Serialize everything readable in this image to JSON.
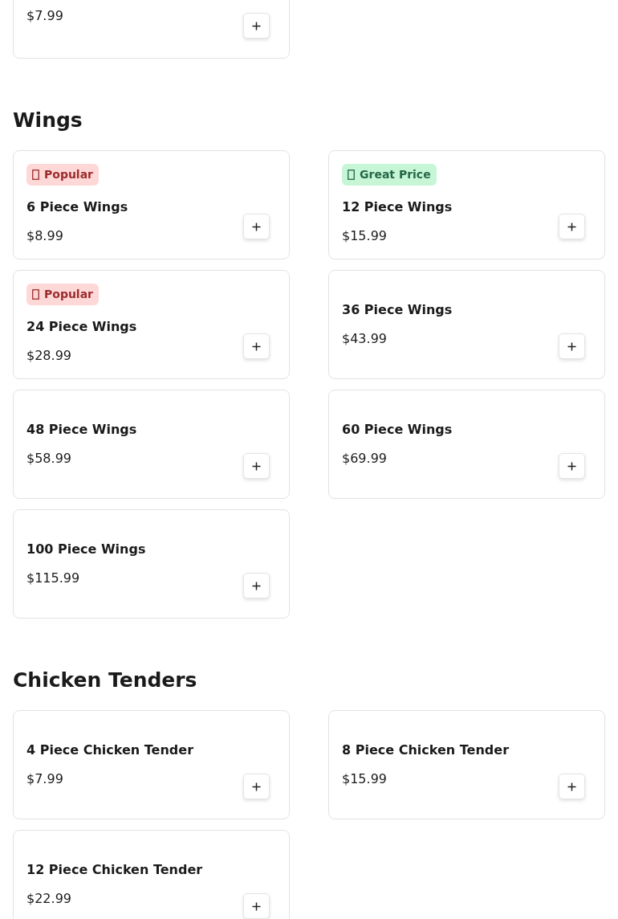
{
  "sections": [
    {
      "items": [
        {
          "price": "$7.99",
          "kind": "partial"
        }
      ]
    },
    {
      "heading": "Wings",
      "items": [
        {
          "badge": {
            "kind": "popular",
            "label": "Popular"
          },
          "name": "6 Piece Wings",
          "price": "$8.99"
        },
        {
          "badge": {
            "kind": "great",
            "label": "Great Price"
          },
          "name": "12 Piece Wings",
          "price": "$15.99"
        },
        {
          "badge": {
            "kind": "popular",
            "label": "Popular"
          },
          "name": "24 Piece Wings",
          "price": "$28.99"
        },
        {
          "name": "36 Piece Wings",
          "price": "$43.99"
        },
        {
          "name": "48 Piece Wings",
          "price": "$58.99"
        },
        {
          "name": "60 Piece Wings",
          "price": "$69.99"
        },
        {
          "name": "100 Piece Wings",
          "price": "$115.99"
        }
      ]
    },
    {
      "heading": "Chicken Tenders",
      "items": [
        {
          "name": "4 Piece Chicken Tender",
          "price": "$7.99"
        },
        {
          "name": "8 Piece Chicken Tender",
          "price": "$15.99"
        },
        {
          "name": "12 Piece Chicken Tender",
          "price": "$22.99"
        }
      ]
    }
  ]
}
